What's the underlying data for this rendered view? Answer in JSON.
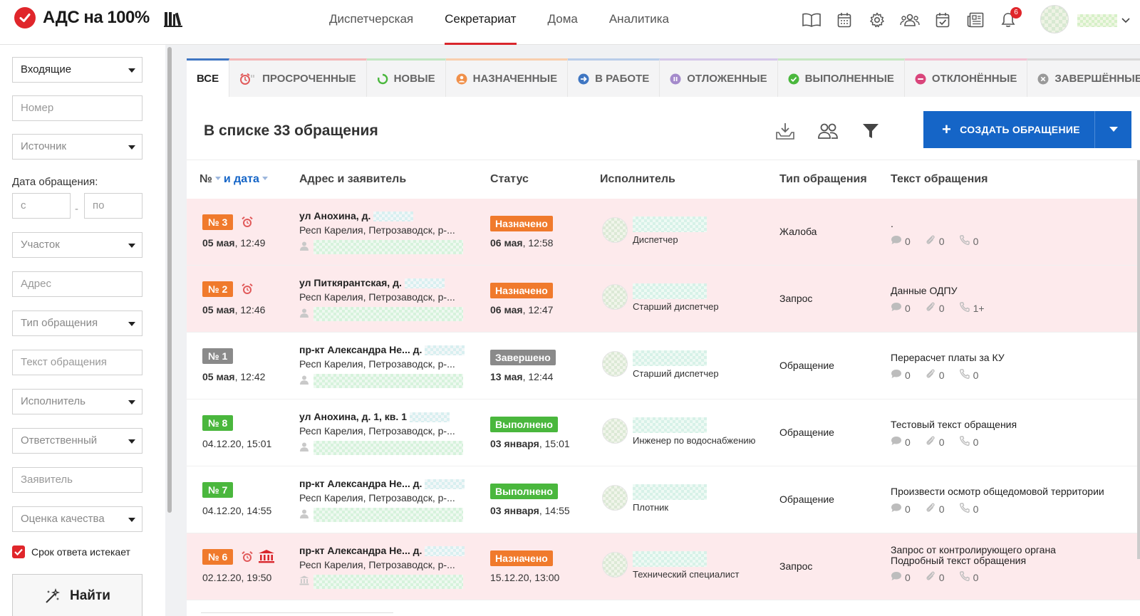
{
  "brand": {
    "name": "АДС на 100%",
    "logo_icon": "check-circle-icon",
    "library_icon": "library-icon"
  },
  "nav": {
    "items": [
      "Диспетчерская",
      "Секретариат",
      "Дома",
      "Аналитика"
    ],
    "active": "Секретариат"
  },
  "header_icons": [
    "book-icon",
    "calendar-icon",
    "gear-icon",
    "users-icon",
    "calendar-check-icon",
    "news-icon",
    "bell-icon"
  ],
  "notifications": {
    "count": "6"
  },
  "filters": {
    "direction": "Входящие",
    "number_placeholder": "Номер",
    "source_placeholder": "Источник",
    "date_label": "Дата обращения:",
    "date_from_placeholder": "с",
    "date_sep": "-",
    "date_to_placeholder": "по",
    "district_placeholder": "Участок",
    "address_placeholder": "Адрес",
    "type_placeholder": "Тип обращения",
    "text_placeholder": "Текст обращения",
    "executor_placeholder": "Исполнитель",
    "responsible_placeholder": "Ответственный",
    "applicant_placeholder": "Заявитель",
    "quality_placeholder": "Оценка качества",
    "deadline_label": "Срок ответа истекает",
    "deadline_checked": true,
    "find_label": "Найти"
  },
  "tabs": [
    {
      "label": "ВСЕ",
      "icon": "",
      "color": "#3f76c2"
    },
    {
      "label": "ПРОСРОЧЕННЫЕ",
      "icon": "alarm-icon",
      "color": "#f4b8b8"
    },
    {
      "label": "НОВЫЕ",
      "icon": "spinner-icon",
      "color": "#c3e6c3"
    },
    {
      "label": "НАЗНАЧЕННЫЕ",
      "icon": "user-circle-icon",
      "color": "#f8cfae"
    },
    {
      "label": "В РАБОТЕ",
      "icon": "arrow-circle-icon",
      "color": "#b9cde9"
    },
    {
      "label": "ОТЛОЖЕННЫЕ",
      "icon": "pause-circle-icon",
      "color": "#d5c7e9"
    },
    {
      "label": "ВЫПОЛНЕННЫЕ",
      "icon": "check-circle-icon",
      "color": "#c6e7c2"
    },
    {
      "label": "ОТКЛОНЁННЫЕ",
      "icon": "minus-circle-icon",
      "color": "#f2c2d2"
    },
    {
      "label": "ЗАВЕРШЁННЫЕ",
      "icon": "x-circle-icon",
      "color": "#d9d9d9"
    }
  ],
  "list": {
    "count_text": "В списке 33 обращения",
    "tools": [
      "download-icon",
      "group-icon",
      "filter-icon"
    ],
    "create_label": "СОЗДАТЬ ОБРАЩЕНИЕ",
    "columns": {
      "num": "№",
      "and_date": "и дата",
      "address": "Адрес и заявитель",
      "status": "Статус",
      "executor": "Исполнитель",
      "type": "Тип обращения",
      "text": "Текст обращения"
    }
  },
  "rows": [
    {
      "num": "№ 3",
      "num_color": "orange",
      "overdue": true,
      "authority": false,
      "date_bold": "05 мая",
      "date_rest": ", 12:49",
      "addr1": "ул Анохина, д.",
      "addr2": "Респ Карелия, Петрозаводск, р-...",
      "applicant_icon": "person-icon",
      "status": "Назначено",
      "status_color": "orange",
      "status_date_bold": "06 мая",
      "status_date_rest": ", 12:58",
      "executor_role": "Диспетчер",
      "type": "Жалоба",
      "text_lines": [
        "."
      ],
      "comments": "0",
      "attachments": "0",
      "calls": "0",
      "pink": true
    },
    {
      "num": "№ 2",
      "num_color": "orange",
      "overdue": true,
      "authority": false,
      "date_bold": "05 мая",
      "date_rest": ", 12:46",
      "addr1": "ул Питкярантская, д.",
      "addr2": "Респ Карелия, Петрозаводск, р-...",
      "applicant_icon": "person-icon",
      "status": "Назначено",
      "status_color": "orange",
      "status_date_bold": "06 мая",
      "status_date_rest": ", 12:47",
      "executor_role": "Старший диспетчер",
      "type": "Запрос",
      "text_lines": [
        "Данные ОДПУ"
      ],
      "comments": "0",
      "attachments": "0",
      "calls": "1+",
      "pink": true
    },
    {
      "num": "№ 1",
      "num_color": "grey",
      "overdue": false,
      "authority": false,
      "date_bold": "05 мая",
      "date_rest": ", 12:42",
      "addr1": "пр-кт Александра Не...  д.",
      "addr2": "Респ Карелия, Петрозаводск, р-...",
      "applicant_icon": "person-icon",
      "status": "Завершено",
      "status_color": "grey",
      "status_date_bold": "13 мая",
      "status_date_rest": ", 12:44",
      "executor_role": "Старший диспетчер",
      "type": "Обращение",
      "text_lines": [
        "Перерасчет платы за КУ"
      ],
      "comments": "0",
      "attachments": "0",
      "calls": "0",
      "pink": false
    },
    {
      "num": "№ 8",
      "num_color": "green",
      "overdue": false,
      "authority": false,
      "date_bold": "",
      "date_rest": "04.12.20, 15:01",
      "addr1": "ул Анохина, д. 1, кв. 1",
      "addr2": "Респ Карелия, Петрозаводск, р-...",
      "applicant_icon": "person-icon",
      "status": "Выполнено",
      "status_color": "green",
      "status_date_bold": "03 января",
      "status_date_rest": ", 15:01",
      "executor_role": "Инженер по водоснабжению",
      "type": "Обращение",
      "text_lines": [
        "Тестовый текст обращения"
      ],
      "comments": "0",
      "attachments": "0",
      "calls": "0",
      "pink": false
    },
    {
      "num": "№ 7",
      "num_color": "green",
      "overdue": false,
      "authority": false,
      "date_bold": "",
      "date_rest": "04.12.20, 14:55",
      "addr1": "пр-кт Александра Не...  д.",
      "addr2": "Респ Карелия, Петрозаводск, р-...",
      "applicant_icon": "person-icon",
      "status": "Выполнено",
      "status_color": "green",
      "status_date_bold": "03 января",
      "status_date_rest": ", 14:55",
      "executor_role": "Плотник",
      "type": "Обращение",
      "text_lines": [
        "Произвести осмотр общедомовой территории"
      ],
      "comments": "0",
      "attachments": "0",
      "calls": "0",
      "pink": false
    },
    {
      "num": "№ 6",
      "num_color": "orange",
      "overdue": true,
      "authority": true,
      "date_bold": "",
      "date_rest": "02.12.20, 19:50",
      "addr1": "пр-кт Александра Не...  д.",
      "addr2": "Респ Карелия, Петрозаводск, р-...",
      "applicant_icon": "bank-icon",
      "status": "Назначено",
      "status_color": "orange",
      "status_date_bold": "",
      "status_date_rest": "15.12.20, 13:00",
      "executor_role": "Технический специалист",
      "type": "Запрос",
      "text_lines": [
        "Запрос от контролирующего органа",
        "Подробный текст обращения"
      ],
      "comments": "0",
      "attachments": "0",
      "calls": "0",
      "pink": true
    }
  ]
}
